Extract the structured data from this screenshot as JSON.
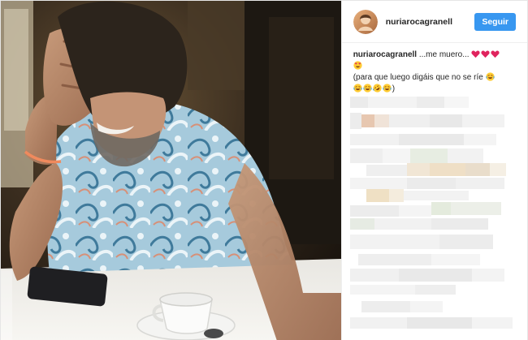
{
  "post": {
    "username": "nuriarocagranell",
    "follow_label": "Seguir",
    "caption": {
      "username": "nuriarocagranell",
      "line1": " ...me muero... ",
      "line3": "(para que luego digáis que no se ríe "
    }
  },
  "icons": {
    "heart": "red-heart-icon",
    "heart_eyes": "heart-eyes-emoji-icon",
    "crying_laughing": "crying-laughing-emoji-icon",
    "rofl": "rolling-on-floor-laughing-emoji-icon"
  },
  "colors": {
    "follow_button": "#3897f0",
    "heart": "#e0245e",
    "username": "#262626"
  }
}
